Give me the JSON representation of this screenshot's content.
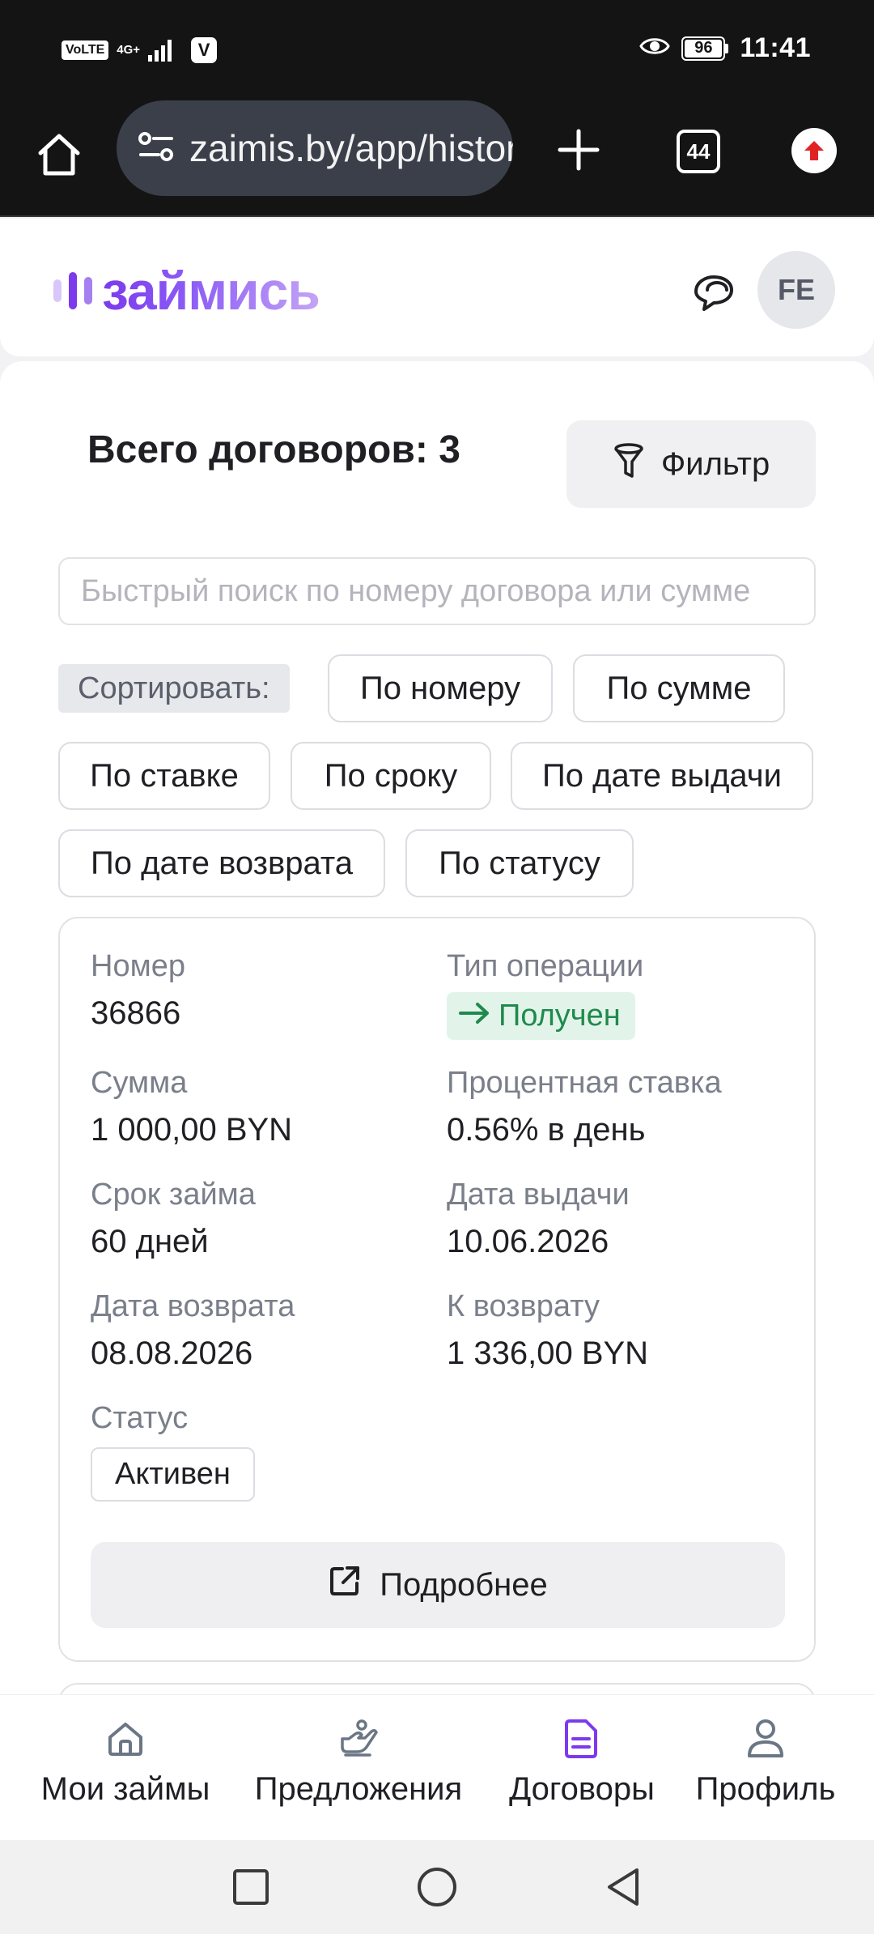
{
  "status_bar": {
    "network_volte": "VoLTE",
    "network_type": "4G+",
    "app_badge": "V",
    "battery_percent": "96",
    "time": "11:41"
  },
  "browser": {
    "url": "zaimis.by/app/history",
    "tabs_count": "44"
  },
  "header": {
    "logo_text": "займись",
    "avatar_initials": "FE",
    "colors": {
      "brand_primary": "#7c3aed",
      "brand_light": "#c4a5f5"
    }
  },
  "contracts": {
    "total_label": "Всего договоров: 3",
    "filter_label": "Фильтр",
    "search_placeholder": "Быстрый поиск по номеру договора или сумме",
    "sort_label": "Сортировать:",
    "sort_options": [
      "По номеру",
      "По сумме",
      "По ставке",
      "По сроку",
      "По дате выдачи",
      "По дате возврата",
      "По статусу"
    ]
  },
  "card": {
    "number_label": "Номер",
    "number_value": "36866",
    "operation_label": "Тип операции",
    "operation_value": "Получен",
    "amount_label": "Сумма",
    "amount_value": "1 000,00 BYN",
    "rate_label": "Процентная ставка",
    "rate_value": "0.56% в день",
    "term_label": "Срок займа",
    "term_value": "60 дней",
    "issue_date_label": "Дата выдачи",
    "issue_date_value": "10.06.2026",
    "return_date_label": "Дата возврата",
    "return_date_value": "08.08.2026",
    "to_return_label": "К возврату",
    "to_return_value": "1 336,00 BYN",
    "status_label": "Статус",
    "status_value": "Активен",
    "details_label": "Подробнее"
  },
  "bottom_nav": {
    "items": [
      {
        "label": "Мои займы",
        "icon": "home-icon"
      },
      {
        "label": "Предложения",
        "icon": "hand-offer-icon"
      },
      {
        "label": "Договоры",
        "icon": "document-icon",
        "active": true
      },
      {
        "label": "Профиль",
        "icon": "user-icon"
      }
    ],
    "active_color": "#7c3aed"
  }
}
